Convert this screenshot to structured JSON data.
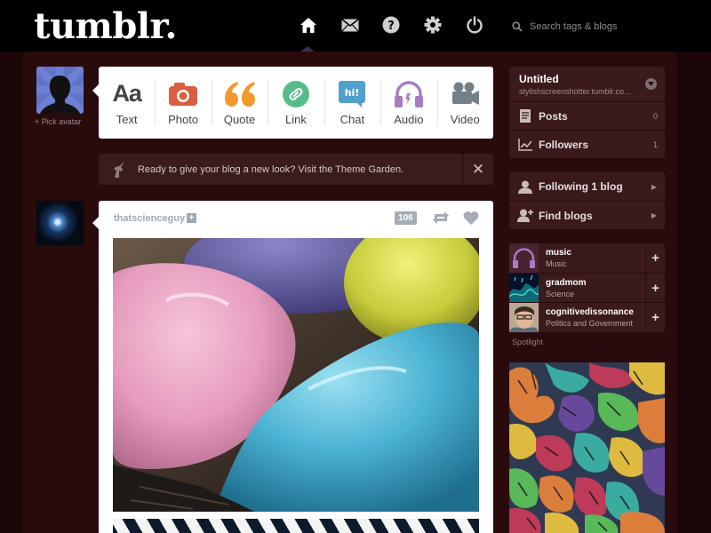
{
  "header": {
    "logo": "tumblr.",
    "nav": [
      {
        "icon": "home-icon",
        "active": true
      },
      {
        "icon": "mail-icon"
      },
      {
        "icon": "help-icon"
      },
      {
        "icon": "gear-icon"
      },
      {
        "icon": "power-icon"
      }
    ],
    "search_placeholder": "Search tags & blogs"
  },
  "avatar": {
    "pick_label": "+ Pick avatar"
  },
  "compose": [
    {
      "label": "Text",
      "glyph": "Aa",
      "color": "#444444"
    },
    {
      "label": "Photo",
      "color": "#d95e40"
    },
    {
      "label": "Quote",
      "color": "#f2992e"
    },
    {
      "label": "Link",
      "color": "#56bc8a"
    },
    {
      "label": "Chat",
      "glyph": "hi!",
      "color": "#529ecc"
    },
    {
      "label": "Audio",
      "color": "#a77dc2"
    },
    {
      "label": "Video",
      "color": "#748089"
    }
  ],
  "notice": {
    "text": "Ready to give your blog a new look? Visit the Theme Garden.",
    "close": "✕"
  },
  "post": {
    "author": "thatscienceguy",
    "notes": "106"
  },
  "sidebar": {
    "blog": {
      "title": "Untitled",
      "url": "stylishscreenshotter.tumblr.co...",
      "rows": [
        {
          "label": "Posts",
          "count": "0"
        },
        {
          "label": "Followers",
          "count": "1"
        }
      ]
    },
    "follow": [
      {
        "label": "Following 1 blog"
      },
      {
        "label": "Find blogs"
      }
    ],
    "recommended": [
      {
        "name": "music",
        "category": "Music"
      },
      {
        "name": "gradmom",
        "category": "Science"
      },
      {
        "name": "cognitivedissonance",
        "category": "Politics and Government"
      }
    ],
    "spotlight_label": "Spotlight"
  }
}
